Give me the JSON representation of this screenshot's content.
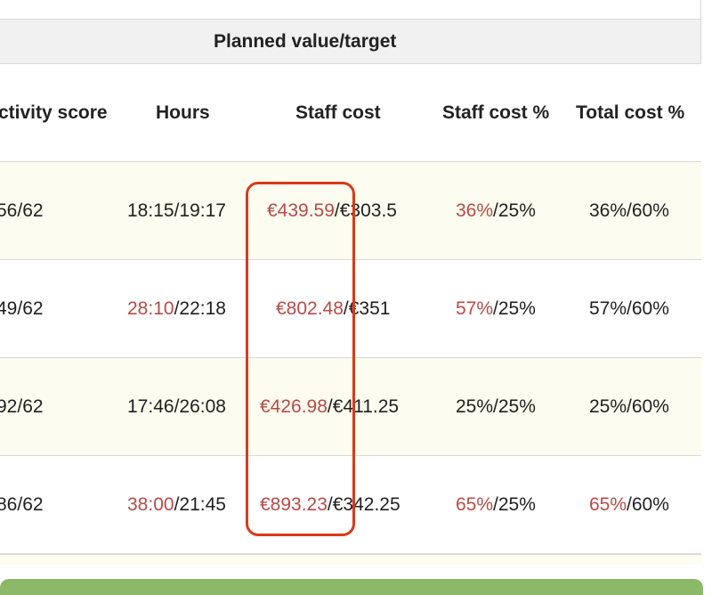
{
  "table": {
    "group_header": "Planned value/target",
    "columns": {
      "productivity_score": "ctivity score",
      "hours": "Hours",
      "staff_cost": "Staff cost",
      "staff_cost_pct": "Staff cost %",
      "total_cost_pct": "Total cost %"
    },
    "rows": [
      {
        "productivity_score": "56/62",
        "hours_actual": "18:15",
        "hours_target": "/19:17",
        "staff_cost_actual": "€439.59",
        "staff_cost_target": "/€303.5",
        "staff_cost_pct_actual": "36%",
        "staff_cost_pct_target": "/25%",
        "total_cost_pct_actual": "36%",
        "total_cost_pct_target": "/60%"
      },
      {
        "productivity_score": "49/62",
        "hours_actual": "28:10",
        "hours_target": "/22:18",
        "staff_cost_actual": "€802.48",
        "staff_cost_target": "/€351",
        "staff_cost_pct_actual": "57%",
        "staff_cost_pct_target": "/25%",
        "total_cost_pct_actual": "57%",
        "total_cost_pct_target": "/60%"
      },
      {
        "productivity_score": "92/62",
        "hours_actual": "17:46",
        "hours_target": "/26:08",
        "staff_cost_actual": "€426.98",
        "staff_cost_target": "/€411.25",
        "staff_cost_pct_actual": "25%",
        "staff_cost_pct_target": "/25%",
        "total_cost_pct_actual": "25%",
        "total_cost_pct_target": "/60%"
      },
      {
        "productivity_score": "86/62",
        "hours_actual": "38:00",
        "hours_target": "/21:45",
        "staff_cost_actual": "€893.23",
        "staff_cost_target": "/€342.25",
        "staff_cost_pct_actual": "65%",
        "staff_cost_pct_target": "/25%",
        "total_cost_pct_actual": "65%",
        "total_cost_pct_target": "/60%"
      }
    ]
  },
  "colors": {
    "over_target": "#b84a46",
    "highlight_border": "#d93a1a",
    "shaded_row": "#fcfcf0",
    "header_bg": "#f1f1f1",
    "action_bar": "#8cb86a"
  }
}
